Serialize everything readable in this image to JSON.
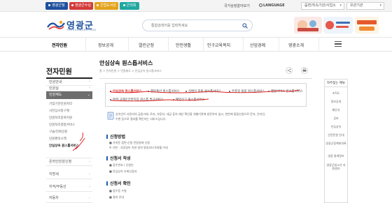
{
  "topbar": {
    "quick_tabs": [
      {
        "label": "영광군청",
        "color": "#1f4f9e"
      },
      {
        "label": "영광군수실",
        "color": "#d33a3a"
      },
      {
        "label": "군립도서관",
        "color": "#e3a21a"
      },
      {
        "label": "군의회",
        "color": "#20a7a0"
      }
    ],
    "lang_link": "국가상징알아보기",
    "language_label": "LANGUAGE",
    "select1": "읍면/직속기관/사업소",
    "select2": "유관기관"
  },
  "header": {
    "logo_text": "영광군",
    "logo_sub": "YEONGGWANG-GUN",
    "search_placeholder": "통합검색어를 입력하세요",
    "colors": {
      "brand": "#1d4f9c"
    }
  },
  "gnb": {
    "items": [
      "전자민원",
      "정보공개",
      "열린군정",
      "안전생활",
      "인구교육복지",
      "산업경제",
      "영광소개"
    ]
  },
  "lnb": {
    "title": "전자민원",
    "rows_top": [
      "민원안내",
      "민원실"
    ],
    "active": "민원제도",
    "sub_items": [
      "기업기관민원처리",
      "사전심사청구제",
      "민원처리중복지원",
      "민원처리결합서비스",
      "구술/전화민원",
      "민원편의시책",
      "안심상속 원스톱서비스"
    ],
    "rows_bottom": [
      "온라인민원신청",
      "지방세",
      "지적/부동산",
      "자동차"
    ]
  },
  "content": {
    "title": "안심상속 원스톱서비스",
    "breadcrumb": "홈 > 전자민원 > 민원제도 > 안심상속 원스톱서비스",
    "tabs_row1": [
      "안심상속 원스톱서비스",
      "행복출산 원스톱서비스",
      "장애인 맞춤 원스톱서비스",
      "온종일 돌봄 원스톱서비스",
      "행정서비스 원스톱서비스"
    ],
    "tabs_row2": [
      "여권·국제운전면허증 원스톱 발급서비스",
      "폐업신고 원스톱서비스"
    ],
    "intro_lines": [
      "상속인이 사망자의 금융거래, 토지, 자동차, 세금 등의 재산 확인을 개별기관에 방문하지 않고, 한번에 통합신청으로 문자, 온라인,",
      "우편 등으로 결과를 확인하는 서비스입니다."
    ],
    "sections": [
      {
        "heading": "신청방법",
        "lines": [
          "■ 가까운 읍면·군청 민원실에 신청",
          "※ 기한 : 사망일이 속한 달의 말일부터 6개월 이내"
        ]
      },
      {
        "heading": "신청서 작성",
        "lines": [
          "■ 접수번호 / 신청인",
          "■ 안심상속 조회신청서"
        ]
      },
      {
        "heading": "신청서 확인",
        "lines": [
          "■ 접수증 수령",
          "■ 결과 안내"
        ]
      }
    ]
  },
  "quick": {
    "title": "자주찾는 메뉴",
    "items": [
      "조직도",
      "정보공개",
      "예산서",
      "공보",
      "안심상속",
      "안전민원 안내",
      "영광군정책회의록",
      "영광 통계정보",
      "영광군청소년 지원센터"
    ]
  }
}
